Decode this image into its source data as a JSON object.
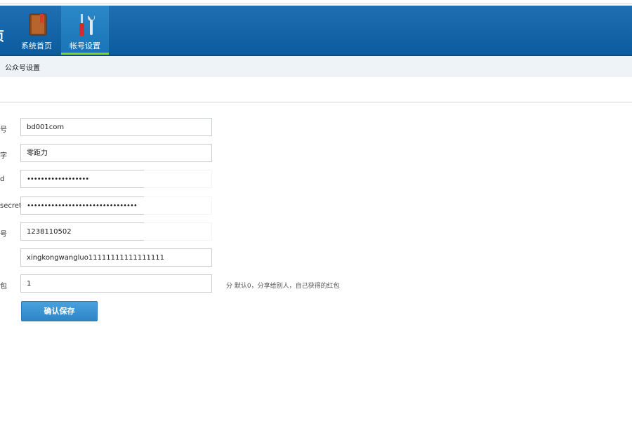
{
  "header": {
    "cut_title": "页",
    "nav": [
      {
        "label": "系统首页",
        "icon": "book-icon"
      },
      {
        "label": "帐号设置",
        "icon": "tools-icon"
      }
    ]
  },
  "breadcrumb": {
    "current": "公众号设置"
  },
  "form": {
    "rows": [
      {
        "label": "号",
        "value": "bd001com"
      },
      {
        "label": "字",
        "value": "零距力"
      },
      {
        "label": "d",
        "value": "••••••••••••••••••"
      },
      {
        "label": "secret",
        "value": "••••••••••••••••••••••••••••••••"
      },
      {
        "label": "号",
        "value": "1238110502"
      },
      {
        "label": "",
        "value": "xingkongwangluo11111111111111111"
      },
      {
        "label": "包",
        "value": "1"
      }
    ],
    "hint": "分 默认0，分享给别人，自己获得的红包",
    "save_label": "确认保存"
  },
  "colors": {
    "header_blue": "#0b5c9f",
    "active_underline": "#7ed321",
    "button_blue": "#3a90d1"
  }
}
